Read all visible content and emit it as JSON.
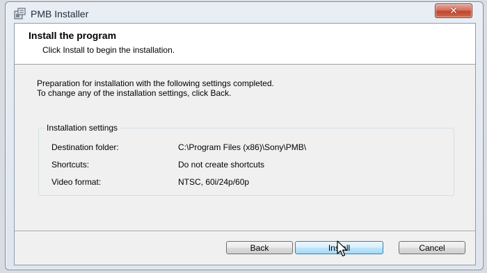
{
  "window": {
    "title": "PMB Installer",
    "close_label": "✕"
  },
  "header": {
    "title": "Install the program",
    "subtitle": "Click Install to begin the installation."
  },
  "description": {
    "line1": "Preparation for installation with the following settings completed.",
    "line2": "To change any of the installation settings, click Back."
  },
  "settings": {
    "group_label": "Installation settings",
    "rows": [
      {
        "label": "Destination folder:",
        "value": "C:\\Program Files (x86)\\Sony\\PMB\\"
      },
      {
        "label": "Shortcuts:",
        "value": "Do not create shortcuts"
      },
      {
        "label": "Video format:",
        "value": "NTSC, 60i/24p/60p"
      }
    ]
  },
  "buttons": {
    "back": "Back",
    "install": "Install",
    "cancel": "Cancel"
  },
  "icons": {
    "app": "installer-icon",
    "cursor": "mouse-pointer-icon"
  }
}
